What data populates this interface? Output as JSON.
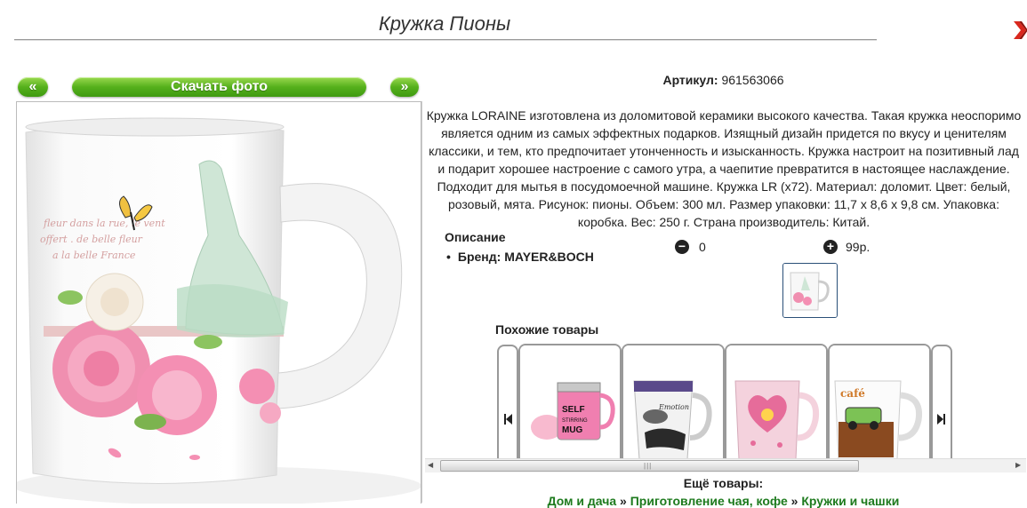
{
  "page": {
    "title": "Кружка Пионы"
  },
  "nav": {
    "prev_label": "«",
    "download_label": "Скачать фото",
    "next_label": "»"
  },
  "product": {
    "sku_label": "Артикул:",
    "sku_value": "961563066",
    "description": "Кружка LORAINE изготовлена из доломитовой керамики высокого качества. Такая кружка неоспоримо является одним из самых эффектных подарков. Изящный дизайн придется по вкусу и ценителям классики, и тем, кто предпочитает утонченность и изысканность. Кружка настроит на позитивный лад и подарит хорошее настроение с самого утра, а чаепитие превратится в настоящее наслаждение. Подходит для мытья в посудомоечной машине. Кружка LR (х72). Материал: доломит. Цвет: белый, розовый, мята. Рисунок: пионы. Объем: 300 мл. Размер упаковки: 11,7 х 8,6 х 9,8 см. Упаковка: коробка. Вес: 250 г. Страна производитель: Китай.",
    "desc_heading": "Описание",
    "brand": "Бренд: MAYER&BOCH",
    "qty_value": "0",
    "price": "99р.",
    "minus_icon": "minus-circle-icon",
    "plus_icon": "plus-circle-icon"
  },
  "similar": {
    "title": "Похожие товары",
    "cards": [
      {
        "name": "SELF STIRRING MUG"
      },
      {
        "name": "Emotion"
      },
      {
        "name": "heart-mug"
      },
      {
        "name": "car-mug"
      }
    ]
  },
  "more": {
    "title": "Ещё товары:",
    "crumbs": [
      "Дом и дача",
      "Приготовление чая, кофе",
      "Кружки и чашки"
    ],
    "separator": "»"
  },
  "colors": {
    "accent_green": "#55b01c",
    "link_green": "#1d7a1d",
    "close_red": "#d9281e"
  }
}
